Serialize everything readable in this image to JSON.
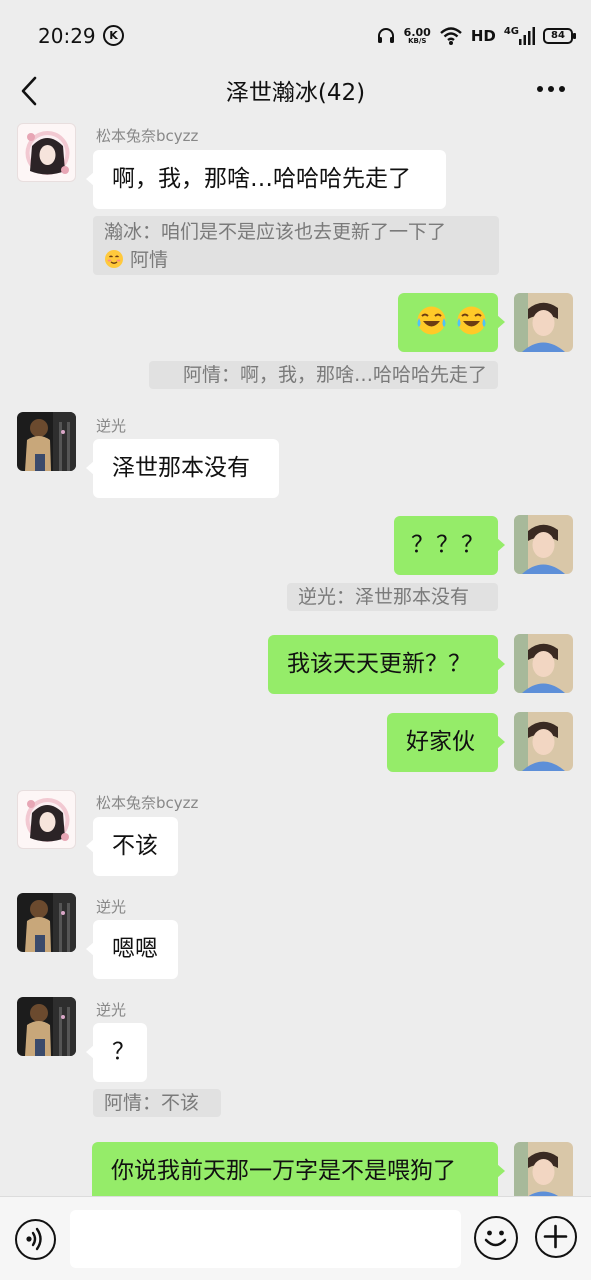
{
  "status_bar": {
    "time": "20:29",
    "k_badge": "K",
    "net_speed_value": "6.00",
    "net_speed_unit": "KB/S",
    "hd": "HD",
    "network": "4G",
    "battery": "84"
  },
  "header": {
    "title": "泽世瀚冰(42)"
  },
  "senders": {
    "songben": "松本兔奈bcyzz",
    "niguang": "逆光"
  },
  "messages": {
    "m1": "啊，我，那啥…哈哈哈先走了",
    "q1_line1": "瀚冰：咱们是不是应该也去更新了一下了",
    "q1_line2": "阿情",
    "q2": "阿情：啊，我，那啥…哈哈哈先走了",
    "m3": "泽世那本没有",
    "m4": "？？？",
    "q3": "逆光：泽世那本没有",
    "m5": "我该天天更新？？",
    "m6": "好家伙",
    "m7": "不该",
    "m8": "嗯嗯",
    "m9": "？",
    "q4": "阿情：不该",
    "m10": "你说我前天那一万字是不是喂狗了"
  },
  "input": {
    "placeholder": ""
  },
  "colors": {
    "background": "#ededed",
    "outgoing_bubble": "#95ec69",
    "incoming_bubble": "#ffffff",
    "quote_bg": "#e1e1e1"
  },
  "icons": {
    "back": "chevron-left-icon",
    "more": "more-dots-icon",
    "voice": "voice-icon",
    "emoji": "emoji-icon",
    "plus": "plus-icon"
  }
}
